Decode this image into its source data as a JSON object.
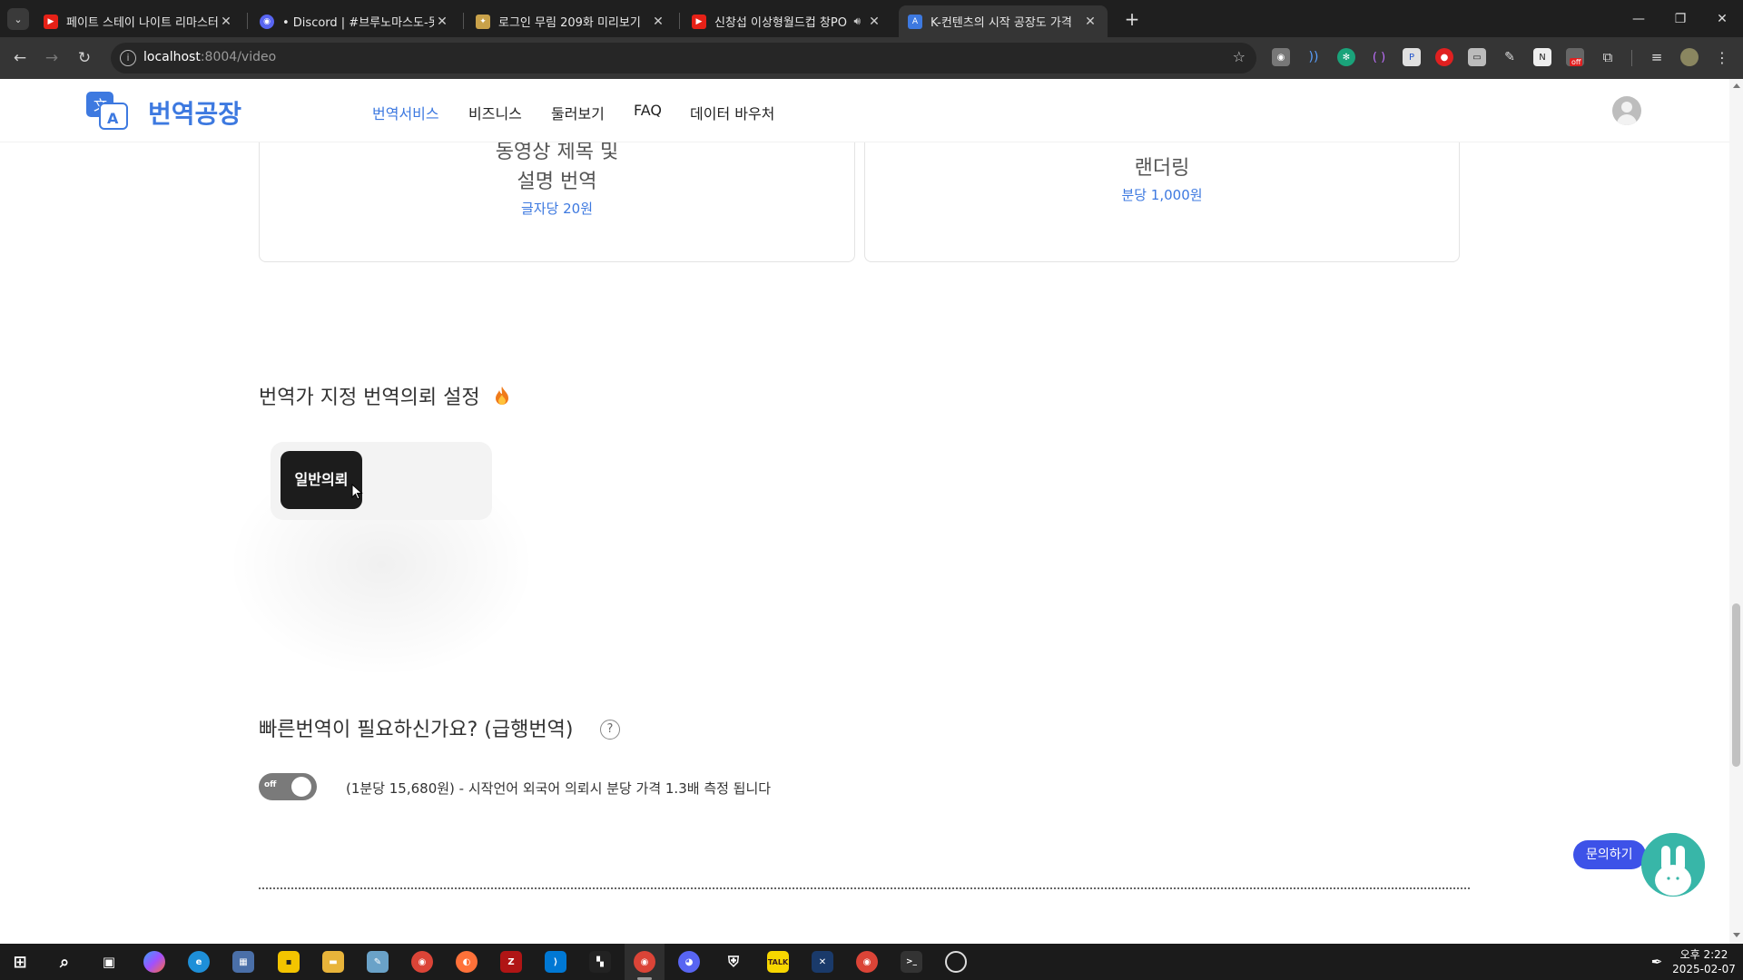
{
  "browser": {
    "tabs": [
      {
        "title": "페이트 스테이 나이트 리마스터",
        "favicon": "youtube-icon"
      },
      {
        "title": "• Discord | #브루노마스도-못숨",
        "favicon": "discord-icon"
      },
      {
        "title": "로그인 무림 209화 미리보기",
        "favicon": "webtoon-icon"
      },
      {
        "title": "신창섭 이상형월드컵 창PO",
        "favicon": "youtube-icon"
      },
      {
        "title": "K-컨텐츠의 시작 공장도 가격",
        "favicon": "translation-factory-icon",
        "active": true
      }
    ],
    "url_host": "localhost",
    "url_path": ":8004/video",
    "extension_badge": "off"
  },
  "site": {
    "logo_text": "번역공장",
    "nav": [
      "번역서비스",
      "비즈니스",
      "둘러보기",
      "FAQ",
      "데이터 바우처"
    ],
    "active_nav": "번역서비스"
  },
  "cards": [
    {
      "title_line1": "동영상 제목 및",
      "title_line2": "설명 번역",
      "price": "글자당 20원"
    },
    {
      "title_line1": "랜더링",
      "price": "분당 1,000원"
    }
  ],
  "translator_section": {
    "title": "번역가 지정 번역의뢰 설정",
    "selected_option": "일반의뢰"
  },
  "urgent_section": {
    "title": "빠른번역이 필요하신가요? (급행번역)",
    "help": "?",
    "toggle_label": "off",
    "toggle_on": false,
    "description": "(1분당 15,680원) - 시작언어 외국어 의뢰시 분당 가격 1.3배 측정 됩니다"
  },
  "inquiry_button": "문의하기",
  "taskbar": {
    "time": "오후 2:22",
    "date": "2025-02-07"
  },
  "colors": {
    "brand": "#3d79e0",
    "inquiry": "#3d52e8"
  }
}
